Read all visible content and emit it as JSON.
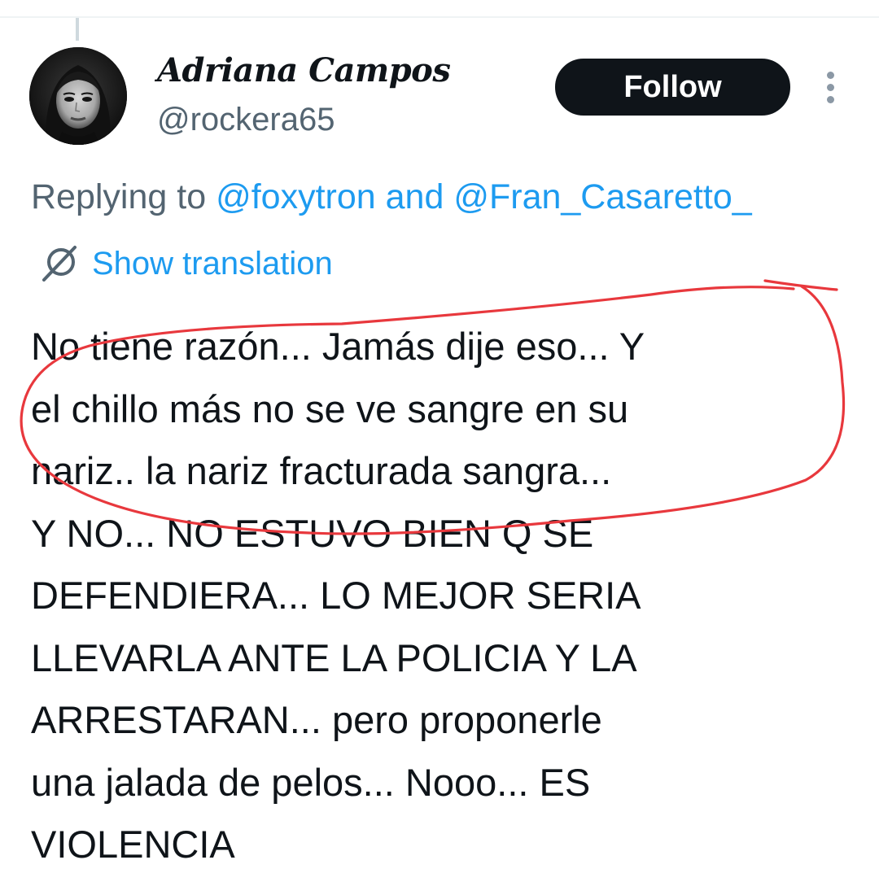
{
  "tweet": {
    "display_name": "Adriana Campos",
    "handle": "@rockera65",
    "follow_label": "Follow",
    "replying_prefix": "Replying to ",
    "reply_user_1": "@foxytron",
    "reply_joiner": " and ",
    "reply_user_2": "@Fran_Casaretto_",
    "show_translation_label": "Show translation",
    "text_lines": [
      "No tiene razón... Jamás dije eso... Y",
      "el chillo más no se ve sangre en su",
      "nariz.. la nariz fracturada sangra...",
      "Y NO... NO ESTUVO BIEN Q SE",
      "DEFENDIERA... LO MEJOR SERIA",
      "LLEVARLA ANTE LA POLICIA Y LA",
      "ARRESTARAN... pero proponerle",
      "una jalada de pelos... Nooo...  ES",
      "VIOLENCIA"
    ]
  },
  "icons": {
    "more": "more-vertical-icon",
    "translation": "translation-globe-icon",
    "annotation": "red-marker-circle"
  },
  "colors": {
    "text": "#0f1419",
    "secondary": "#536471",
    "link": "#1d9bf0",
    "button": "#0f1419",
    "annotation": "#e8383d"
  }
}
